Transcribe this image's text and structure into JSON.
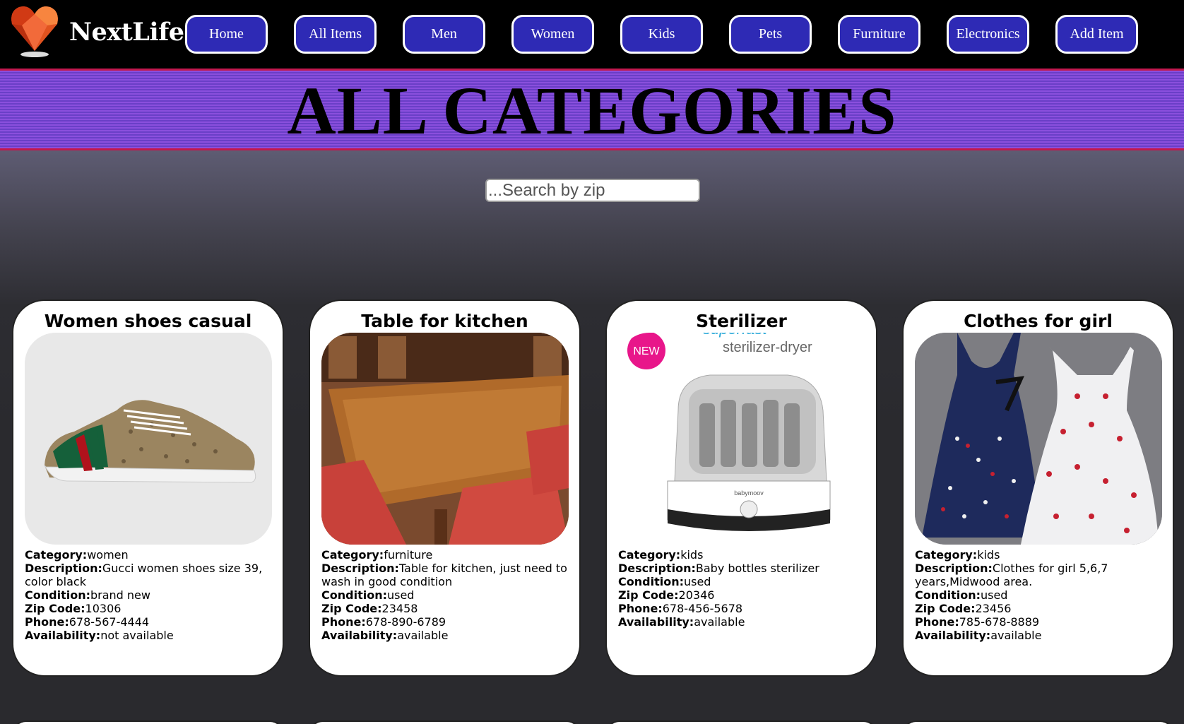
{
  "brand": {
    "name": "NextLife",
    "logo_icon": "heart-gem-icon"
  },
  "nav": [
    {
      "label": "Home"
    },
    {
      "label": "All Items"
    },
    {
      "label": "Men"
    },
    {
      "label": "Women"
    },
    {
      "label": "Kids"
    },
    {
      "label": "Pets"
    },
    {
      "label": "Furniture"
    },
    {
      "label": "Electronics"
    },
    {
      "label": "Add Item"
    }
  ],
  "banner": {
    "title": "ALL CATEGORIES"
  },
  "search": {
    "placeholder": "...Search by zip",
    "value": ""
  },
  "labels": {
    "category": "Category:",
    "description": "Description:",
    "condition": "Condition:",
    "zip": "Zip Code:",
    "phone": "Phone:",
    "availability": "Availability:"
  },
  "items": [
    {
      "title": "Women shoes casual",
      "image": "sneaker-image",
      "category": "women",
      "description": "Gucci women shoes size 39, color black",
      "condition": "brand new",
      "zip": "10306",
      "phone": "678-567-4444",
      "availability": "not available"
    },
    {
      "title": "Table for kitchen",
      "image": "wooden-table-image",
      "category": "furniture",
      "description": "Table for kitchen, just need to wash in good condition",
      "condition": "used",
      "zip": "23458",
      "phone": "678-890-6789",
      "availability": "available"
    },
    {
      "title": "Sterilizer",
      "image": "sterilizer-image",
      "image_text": {
        "badge": "NEW",
        "subtitle": "sterilizer-dryer",
        "top": "superfast",
        "brand": "babymoov"
      },
      "category": "kids",
      "description": "Baby bottles sterilizer",
      "condition": "used",
      "zip": "20346",
      "phone": "678-456-5678",
      "availability": "available"
    },
    {
      "title": "Clothes for girl",
      "image": "girl-dresses-image",
      "category": "kids",
      "description": "Clothes for girl 5,6,7 years,Midwood area.",
      "condition": "used",
      "zip": "23456",
      "phone": "785-678-8889",
      "availability": "available"
    }
  ],
  "colors": {
    "nav_button": "#2e2ab5",
    "banner": "#7a45d2",
    "banner_border": "#c2184e",
    "background": "#2a2a2e"
  }
}
